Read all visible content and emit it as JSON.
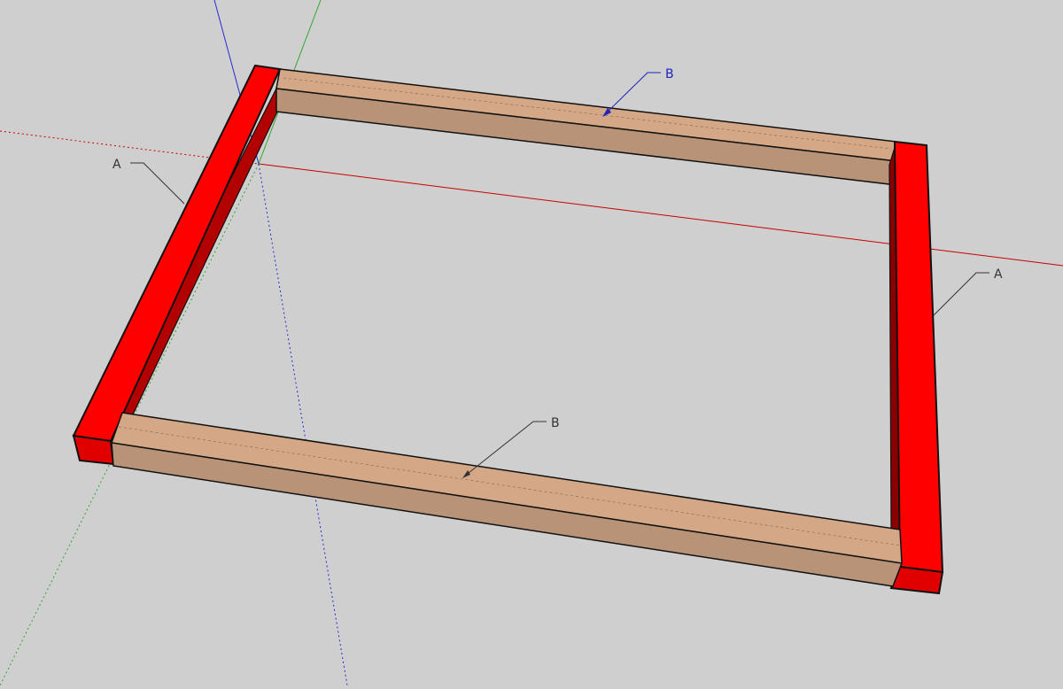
{
  "viewport": {
    "background": "#cfcfcf"
  },
  "colors": {
    "axis_red": "#c80000",
    "axis_green": "#2ea82e",
    "axis_blue": "#2a2ad0",
    "part_a_top": "#ff0000",
    "part_a_side": "#b30000",
    "part_b_top": "#d4a887",
    "part_b_side": "#b89378",
    "edge": "#111111"
  },
  "labels": {
    "top_rail": "B",
    "left_leg": "A",
    "right_leg": "A",
    "bottom_rail": "B"
  }
}
